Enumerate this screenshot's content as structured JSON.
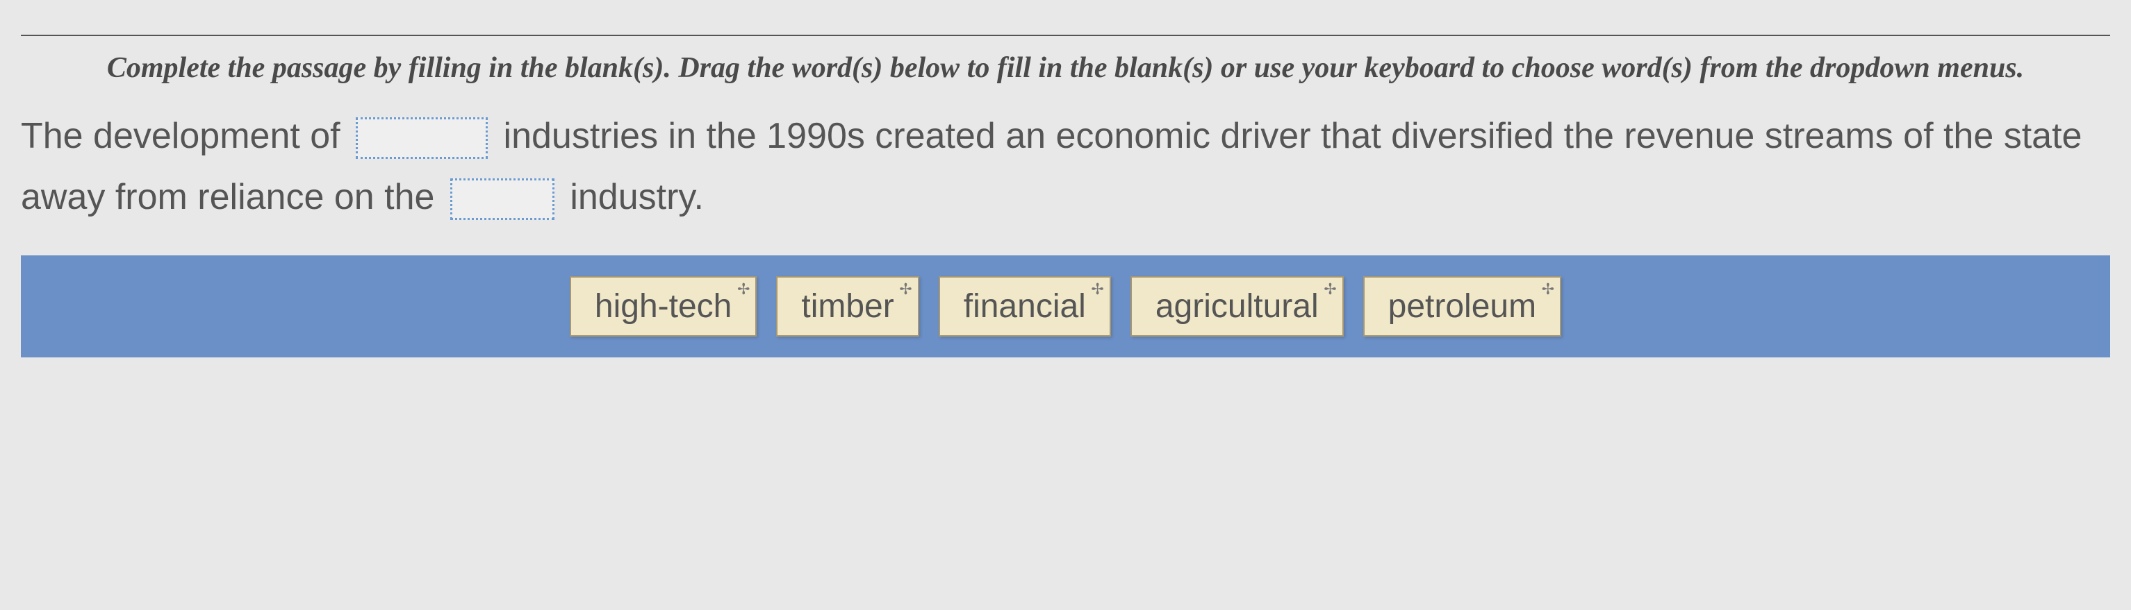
{
  "instructions": "Complete the passage by filling in the blank(s). Drag the word(s) below to fill in the blank(s) or use your keyboard to choose word(s) from the dropdown menus.",
  "passage": {
    "part1": "The development of",
    "part2": "industries in the 1990s created an economic driver that diversified the revenue streams of the state away from reliance on the",
    "part3": "industry."
  },
  "word_bank": [
    "high-tech",
    "timber",
    "financial",
    "agricultural",
    "petroleum"
  ]
}
